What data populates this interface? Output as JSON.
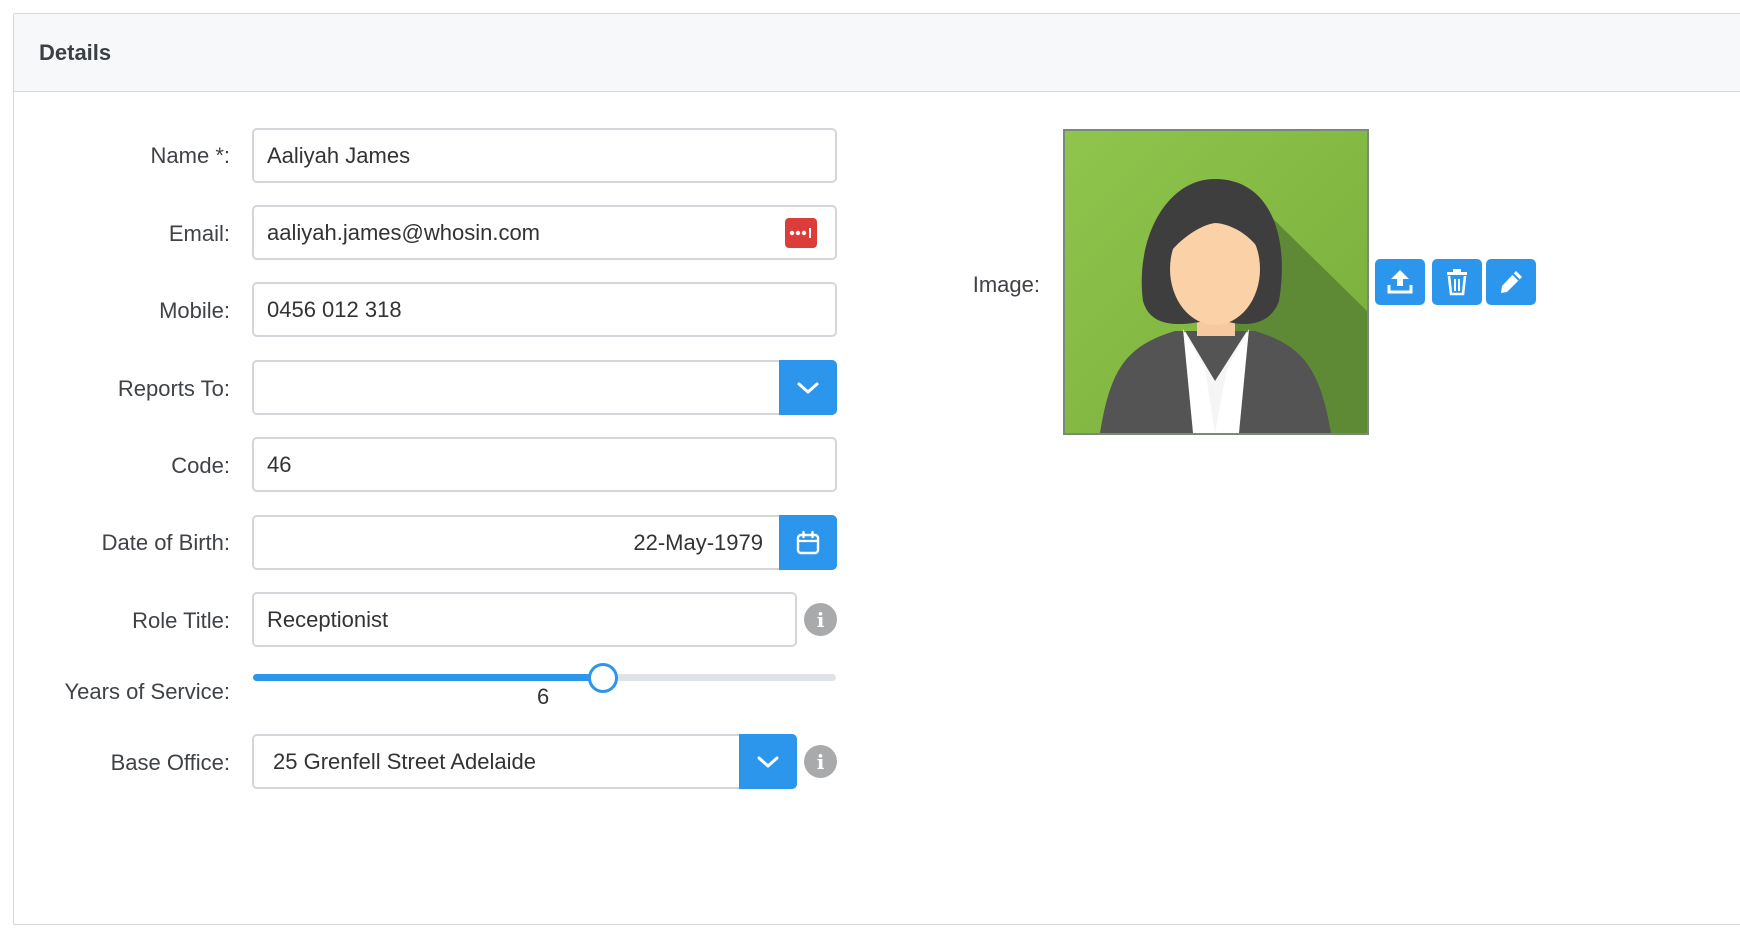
{
  "panel": {
    "title": "Details"
  },
  "form": {
    "name": {
      "label": "Name *:",
      "value": "Aaliyah James"
    },
    "email": {
      "label": "Email:",
      "value": "aaliyah.james@whosin.com",
      "icon": "password-manager-icon"
    },
    "mobile": {
      "label": "Mobile:",
      "value": "0456 012 318"
    },
    "reports_to": {
      "label": "Reports To:",
      "value": ""
    },
    "code": {
      "label": "Code:",
      "value": "46"
    },
    "dob": {
      "label": "Date of Birth:",
      "value": "22-May-1979"
    },
    "role_title": {
      "label": "Role Title:",
      "value": "Receptionist",
      "info_glyph": "i"
    },
    "years_of_service": {
      "label": "Years of Service:",
      "value": "6",
      "fraction": 0.6
    },
    "base_office": {
      "label": "Base Office:",
      "value": "25 Grenfell Street Adelaide",
      "info_glyph": "i"
    }
  },
  "image": {
    "label": "Image:",
    "buttons": [
      "upload-icon",
      "trash-icon",
      "pencil-icon"
    ]
  },
  "colors": {
    "accent": "#2b96eb",
    "danger": "#dc3d3a",
    "photo_bg": "#8bc34a"
  }
}
